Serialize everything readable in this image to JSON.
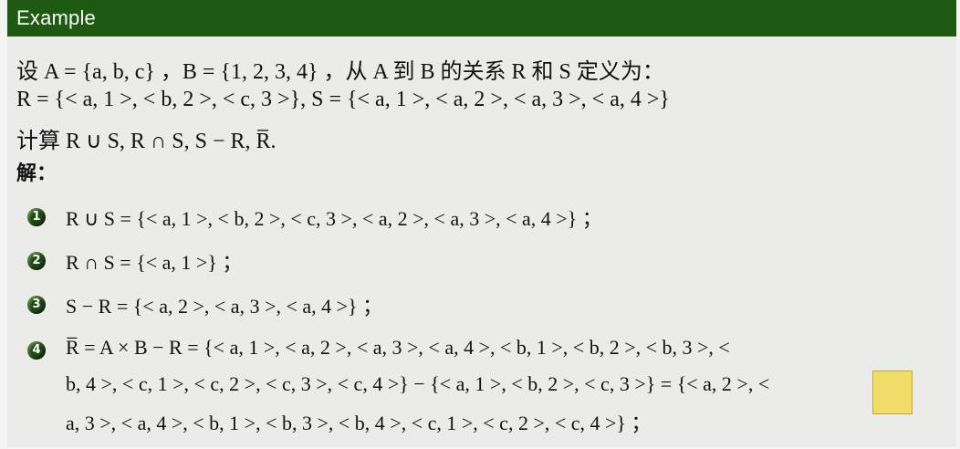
{
  "header": {
    "title": "Example"
  },
  "problem": {
    "line1": "设 A = {a, b, c} ，B = {1, 2, 3, 4} ，从 A 到 B 的关系 R 和 S 定义为：",
    "line2": "R = {< a, 1 >, < b, 2 >, < c, 3 >}, S = {< a, 1 >, < a, 2 >, < a, 3 >, < a, 4 >}",
    "line3": "计算 R ∪ S, R ∩ S, S − R, R̅.",
    "solution_label": "解："
  },
  "steps": [
    {
      "marker": "1",
      "text": "R ∪ S = {< a, 1 >, < b, 2 >, < c, 3 >, < a, 2 >, < a, 3 >, < a, 4 >} ；"
    },
    {
      "marker": "2",
      "text": "R ∩ S = {< a, 1 >} ；"
    },
    {
      "marker": "3",
      "text": "S − R = {< a, 2 >, < a, 3 >, < a, 4 >} ；"
    },
    {
      "marker": "4",
      "line1": "R̅ = A × B − R = {< a, 1 >, < a, 2 >, < a, 3 >, < a, 4 >, < b, 1 >, < b, 2 >, < b, 3 >, <",
      "line2": "b, 4 >, < c, 1 >, < c, 2 >, < c, 3 >, < c, 4 >} − {< a, 1 >, < b, 2 >, < c, 3 >} = {< a, 2 >, <",
      "line3": "a, 3 >, < a, 4 >, < b, 1 >, < b, 3 >, < b, 4 >, < c, 1 >, < c, 2 >, < c, 4 >} ；"
    }
  ]
}
